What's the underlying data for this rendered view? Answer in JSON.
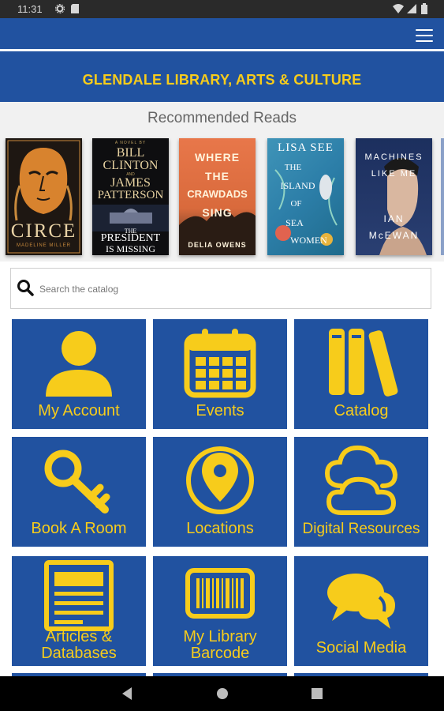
{
  "status_bar": {
    "time": "11:31"
  },
  "header": {
    "title": "GLENDALE LIBRARY, ARTS & CULTURE"
  },
  "recommended": {
    "heading": "Recommended Reads",
    "books": [
      {
        "lines": [
          "CIRCE",
          "MADELINE MILLER"
        ]
      },
      {
        "lines": [
          "A NOVEL BY",
          "BILL",
          "CLINTON",
          "AND",
          "JAMES",
          "PATTERSON",
          "THE",
          "PRESIDENT",
          "IS MISSING"
        ]
      },
      {
        "lines": [
          "WHERE",
          "THE",
          "CRAWDADS",
          "SING",
          "DELIA OWENS"
        ]
      },
      {
        "lines": [
          "LISA SEE",
          "THE",
          "ISLAND",
          "OF",
          "SEA",
          "WOMEN"
        ]
      },
      {
        "lines": [
          "MACHINES",
          "LIKE ME",
          "IAN",
          "McEWAN"
        ]
      }
    ]
  },
  "search": {
    "placeholder": "Search the catalog"
  },
  "tiles": [
    {
      "label": "My Account",
      "icon": "person-icon"
    },
    {
      "label": "Events",
      "icon": "calendar-icon"
    },
    {
      "label": "Catalog",
      "icon": "books-icon"
    },
    {
      "label": "Book A Room",
      "icon": "key-icon"
    },
    {
      "label": "Locations",
      "icon": "location-pin-icon"
    },
    {
      "label": "Digital Resources",
      "icon": "cloud-icon"
    },
    {
      "label_lines": [
        "Articles &",
        "Databases"
      ],
      "icon": "newspaper-icon"
    },
    {
      "label_lines": [
        "My Library",
        "Barcode"
      ],
      "icon": "barcode-icon"
    },
    {
      "label": "Social Media",
      "icon": "chat-bubbles-icon"
    }
  ],
  "colors": {
    "brand_blue": "#2152a0",
    "accent_yellow": "#f7cc1b"
  }
}
